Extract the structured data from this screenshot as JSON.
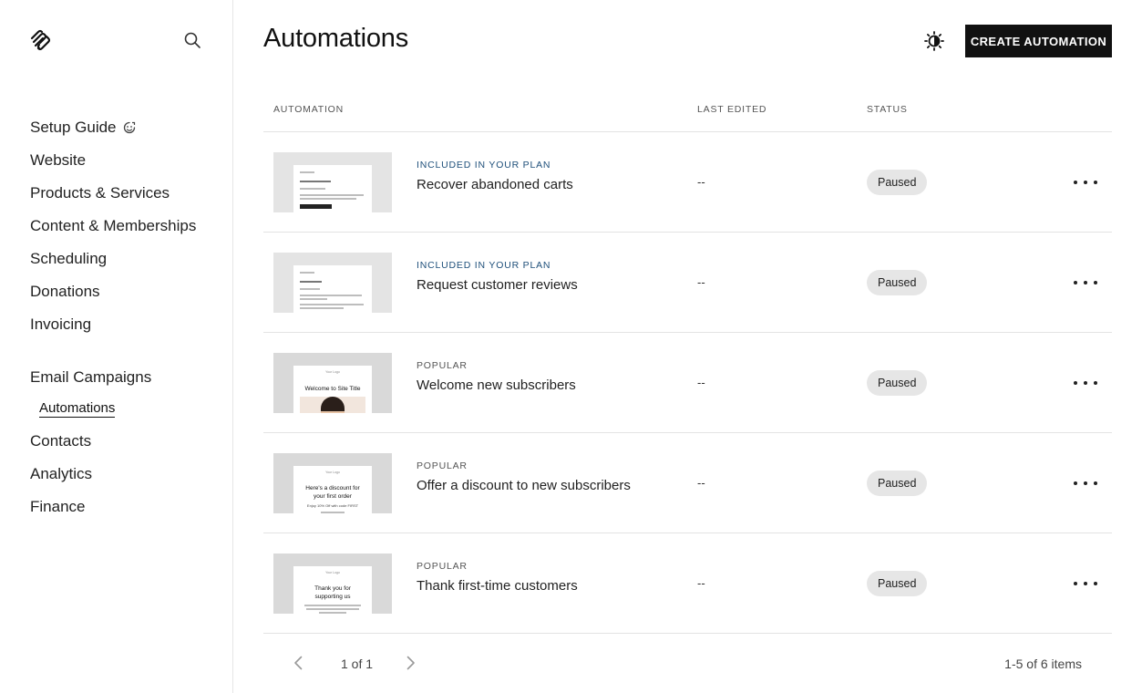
{
  "sidebar": {
    "logo": "squarespace-logo",
    "nav": [
      {
        "label": "Setup Guide"
      },
      {
        "label": "Website"
      },
      {
        "label": "Products & Services"
      },
      {
        "label": "Content & Memberships"
      },
      {
        "label": "Scheduling"
      },
      {
        "label": "Donations"
      },
      {
        "label": "Invoicing"
      }
    ],
    "nav2": [
      {
        "label": "Email Campaigns"
      }
    ],
    "sub": {
      "label": "Automations"
    },
    "nav3": [
      {
        "label": "Contacts"
      },
      {
        "label": "Analytics"
      },
      {
        "label": "Finance"
      }
    ]
  },
  "header": {
    "title": "Automations",
    "create_label": "CREATE AUTOMATION"
  },
  "table": {
    "columns": [
      "AUTOMATION",
      "LAST EDITED",
      "STATUS"
    ],
    "rows": [
      {
        "tag": "INCLUDED IN YOUR PLAN",
        "name": "Recover abandoned carts",
        "edited": "--",
        "status": "Paused"
      },
      {
        "tag": "INCLUDED IN YOUR PLAN",
        "name": "Request customer reviews",
        "edited": "--",
        "status": "Paused"
      },
      {
        "tag": "POPULAR",
        "name": "Welcome new subscribers",
        "edited": "--",
        "status": "Paused"
      },
      {
        "tag": "POPULAR",
        "name": "Offer a discount to new subscribers",
        "edited": "--",
        "status": "Paused"
      },
      {
        "tag": "POPULAR",
        "name": "Thank first-time customers",
        "edited": "--",
        "status": "Paused"
      }
    ]
  },
  "thumbs": {
    "welcome_logo": "Your Logo",
    "welcome_title": "Welcome to Site Title",
    "discount_logo": "Your Logo",
    "discount_title_1": "Here's a discount for",
    "discount_title_2": "your first order",
    "discount_sub": "Enjoy 10% Off with code FIRST",
    "thank_logo": "Your Logo",
    "thank_title_1": "Thank you for",
    "thank_title_2": "supporting us"
  },
  "pagination": {
    "page_label": "1 of 1",
    "count_label": "1-5 of 6 items"
  },
  "colors": {
    "accent": "#111111",
    "plan_tag": "#1e4f7a",
    "status_bg": "#e6e6e6"
  }
}
